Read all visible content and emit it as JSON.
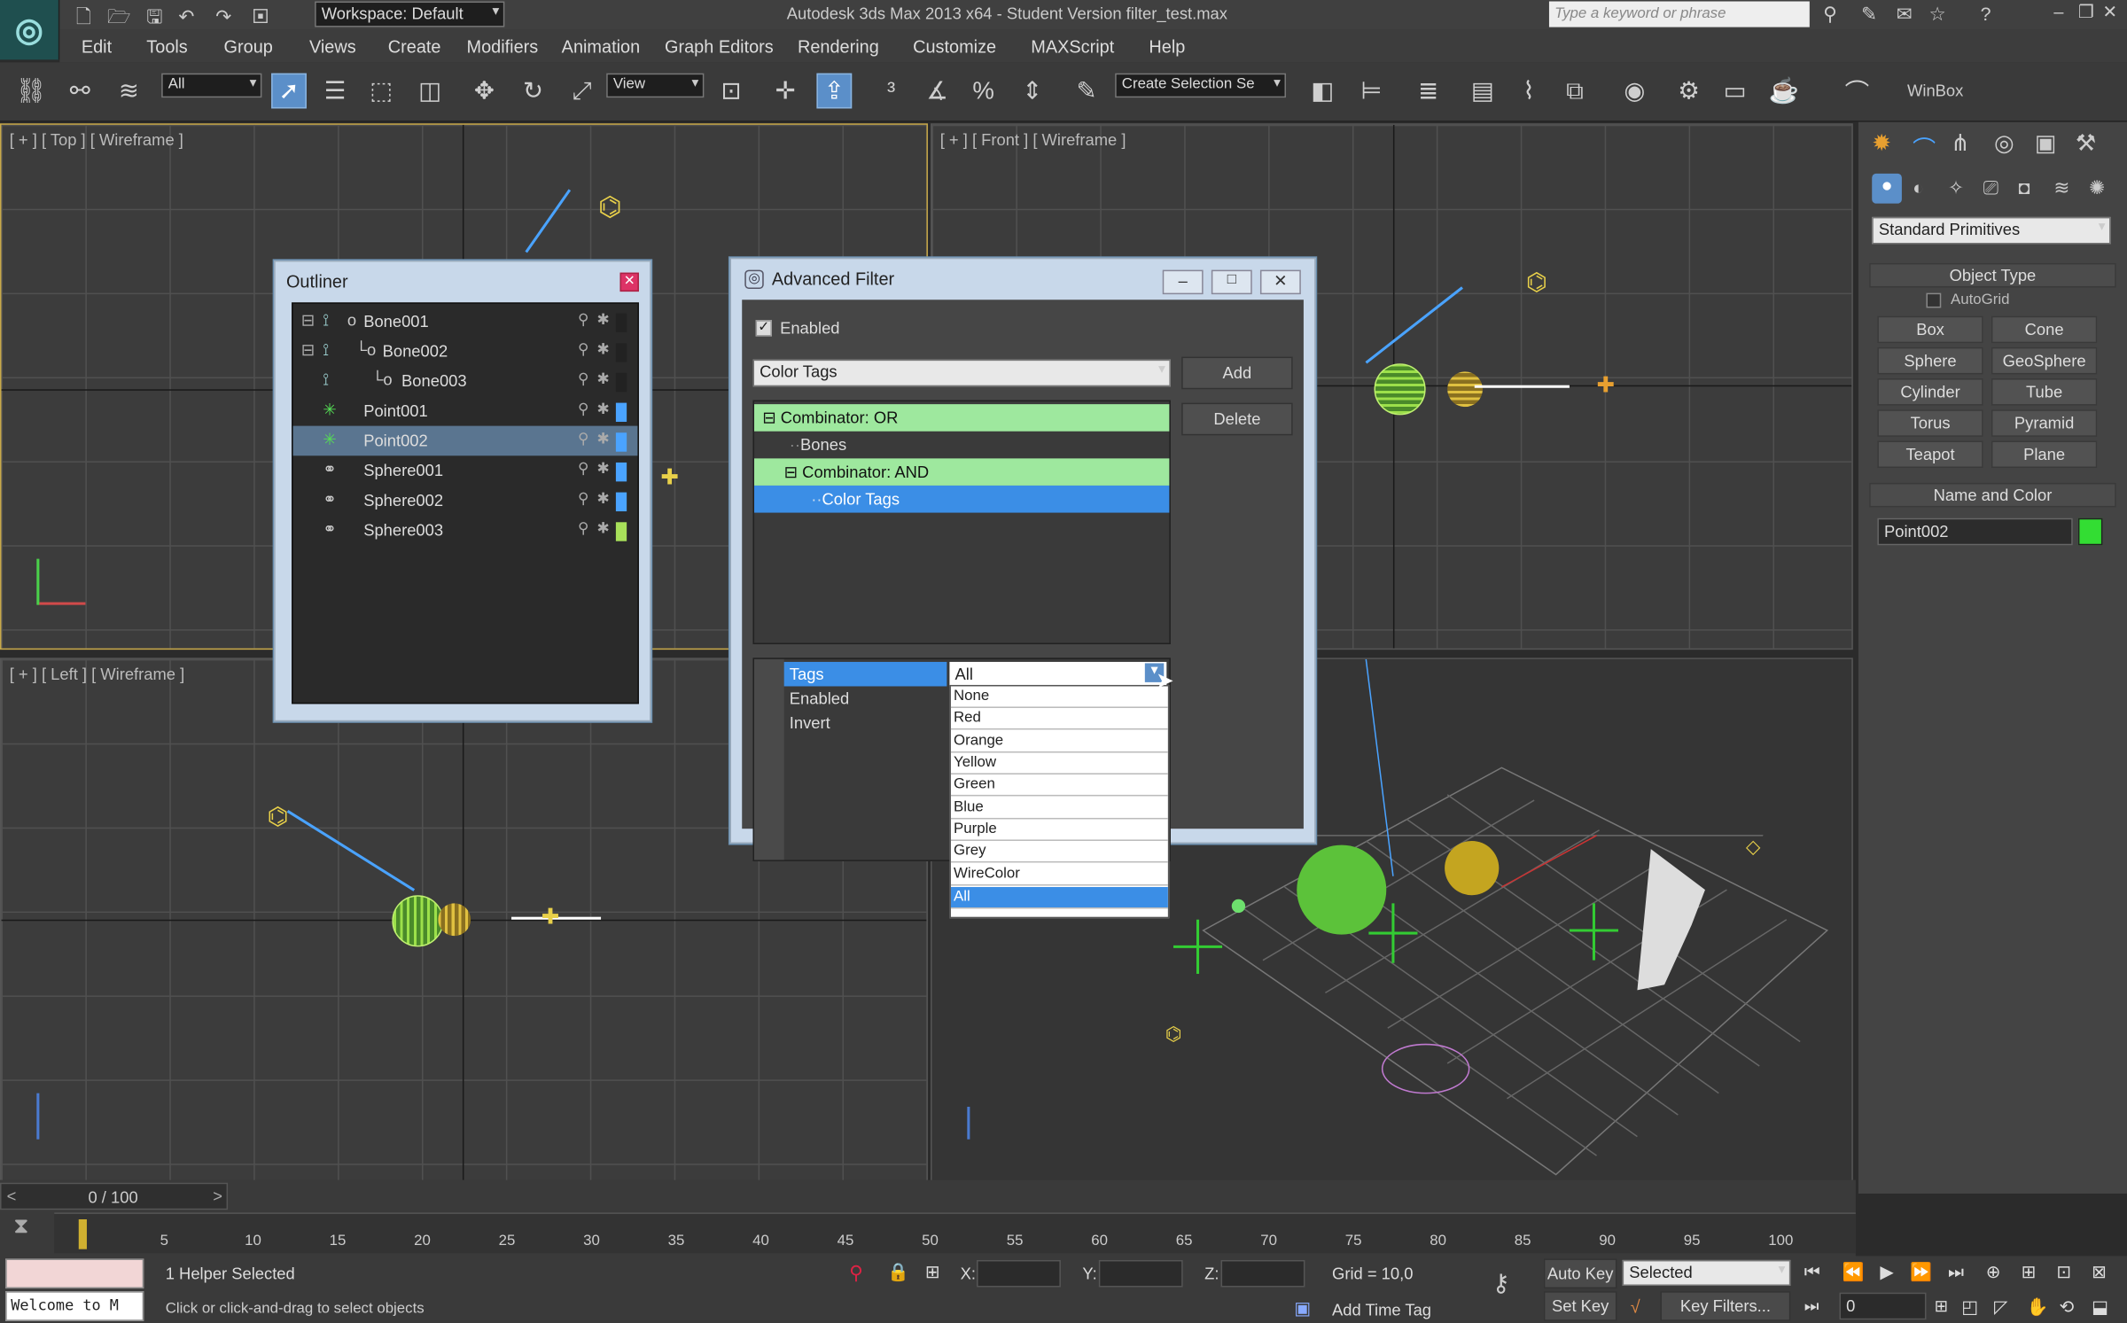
{
  "titlebar": {
    "workspace": "Workspace: Default",
    "title": "Autodesk 3ds Max  2013 x64  - Student Version    filter_test.max",
    "search_placeholder": "Type a keyword or phrase"
  },
  "menu": [
    "Edit",
    "Tools",
    "Group",
    "Views",
    "Create",
    "Modifiers",
    "Animation",
    "Graph Editors",
    "Rendering",
    "Customize",
    "MAXScript",
    "Help"
  ],
  "toolbar": {
    "selection_filter": "All",
    "ref_coord": "View",
    "named_selection": "Create Selection Se",
    "winbox": "WinBox"
  },
  "viewports": {
    "top": "[ + ] [ Top ] [ Wireframe ]",
    "front": "[ + ] [ Front ] [ Wireframe ]",
    "left": "[ + ] [ Left ] [ Wireframe ]"
  },
  "outliner": {
    "title": "Outliner",
    "items": [
      {
        "name": "Bone001",
        "color": "#222222"
      },
      {
        "name": "Bone002",
        "color": "#222222"
      },
      {
        "name": "Bone003",
        "color": "#222222"
      },
      {
        "name": "Point001",
        "color": "#4aa3ff"
      },
      {
        "name": "Point002",
        "color": "#4aa3ff"
      },
      {
        "name": "Sphere001",
        "color": "#4aa3ff"
      },
      {
        "name": "Sphere002",
        "color": "#4aa3ff"
      },
      {
        "name": "Sphere003",
        "color": "#a8e05a"
      }
    ]
  },
  "advanced_filter": {
    "title": "Advanced Filter",
    "enabled_label": "Enabled",
    "filter_type": "Color Tags",
    "add_label": "Add",
    "delete_label": "Delete",
    "tree": [
      "Combinator: OR",
      "Bones",
      "Combinator: AND",
      "Color Tags"
    ],
    "props": [
      {
        "name": "Tags",
        "value": "All"
      },
      {
        "name": "Enabled",
        "value": ""
      },
      {
        "name": "Invert",
        "value": ""
      }
    ],
    "dropdown": [
      "None",
      "Red",
      "Orange",
      "Yellow",
      "Green",
      "Blue",
      "Purple",
      "Grey",
      "WireColor",
      "All"
    ]
  },
  "command_panel": {
    "category": "Standard Primitives",
    "object_type": "Object Type",
    "autogrid": "AutoGrid",
    "buttons": [
      "Box",
      "Cone",
      "Sphere",
      "GeoSphere",
      "Cylinder",
      "Tube",
      "Torus",
      "Pyramid",
      "Teapot",
      "Plane"
    ],
    "name_and_color": "Name and Color",
    "object_name": "Point002",
    "object_color": "#33dd33"
  },
  "timeline": {
    "frame": "0 / 100",
    "ticks": [
      "5",
      "10",
      "15",
      "20",
      "25",
      "30",
      "35",
      "40",
      "45",
      "50",
      "55",
      "60",
      "65",
      "70",
      "75",
      "80",
      "85",
      "90",
      "95",
      "100"
    ]
  },
  "status": {
    "listener": "Welcome to M",
    "selection": "1 Helper Selected",
    "prompt": "Click or click-and-drag to select objects",
    "x_label": "X:",
    "y_label": "Y:",
    "z_label": "Z:",
    "grid": "Grid = 10,0",
    "auto_key": "Auto Key",
    "set_key": "Set Key",
    "key_mode": "Selected",
    "key_filters": "Key Filters...",
    "add_time_tag": "Add Time Tag",
    "current_frame": "0"
  }
}
